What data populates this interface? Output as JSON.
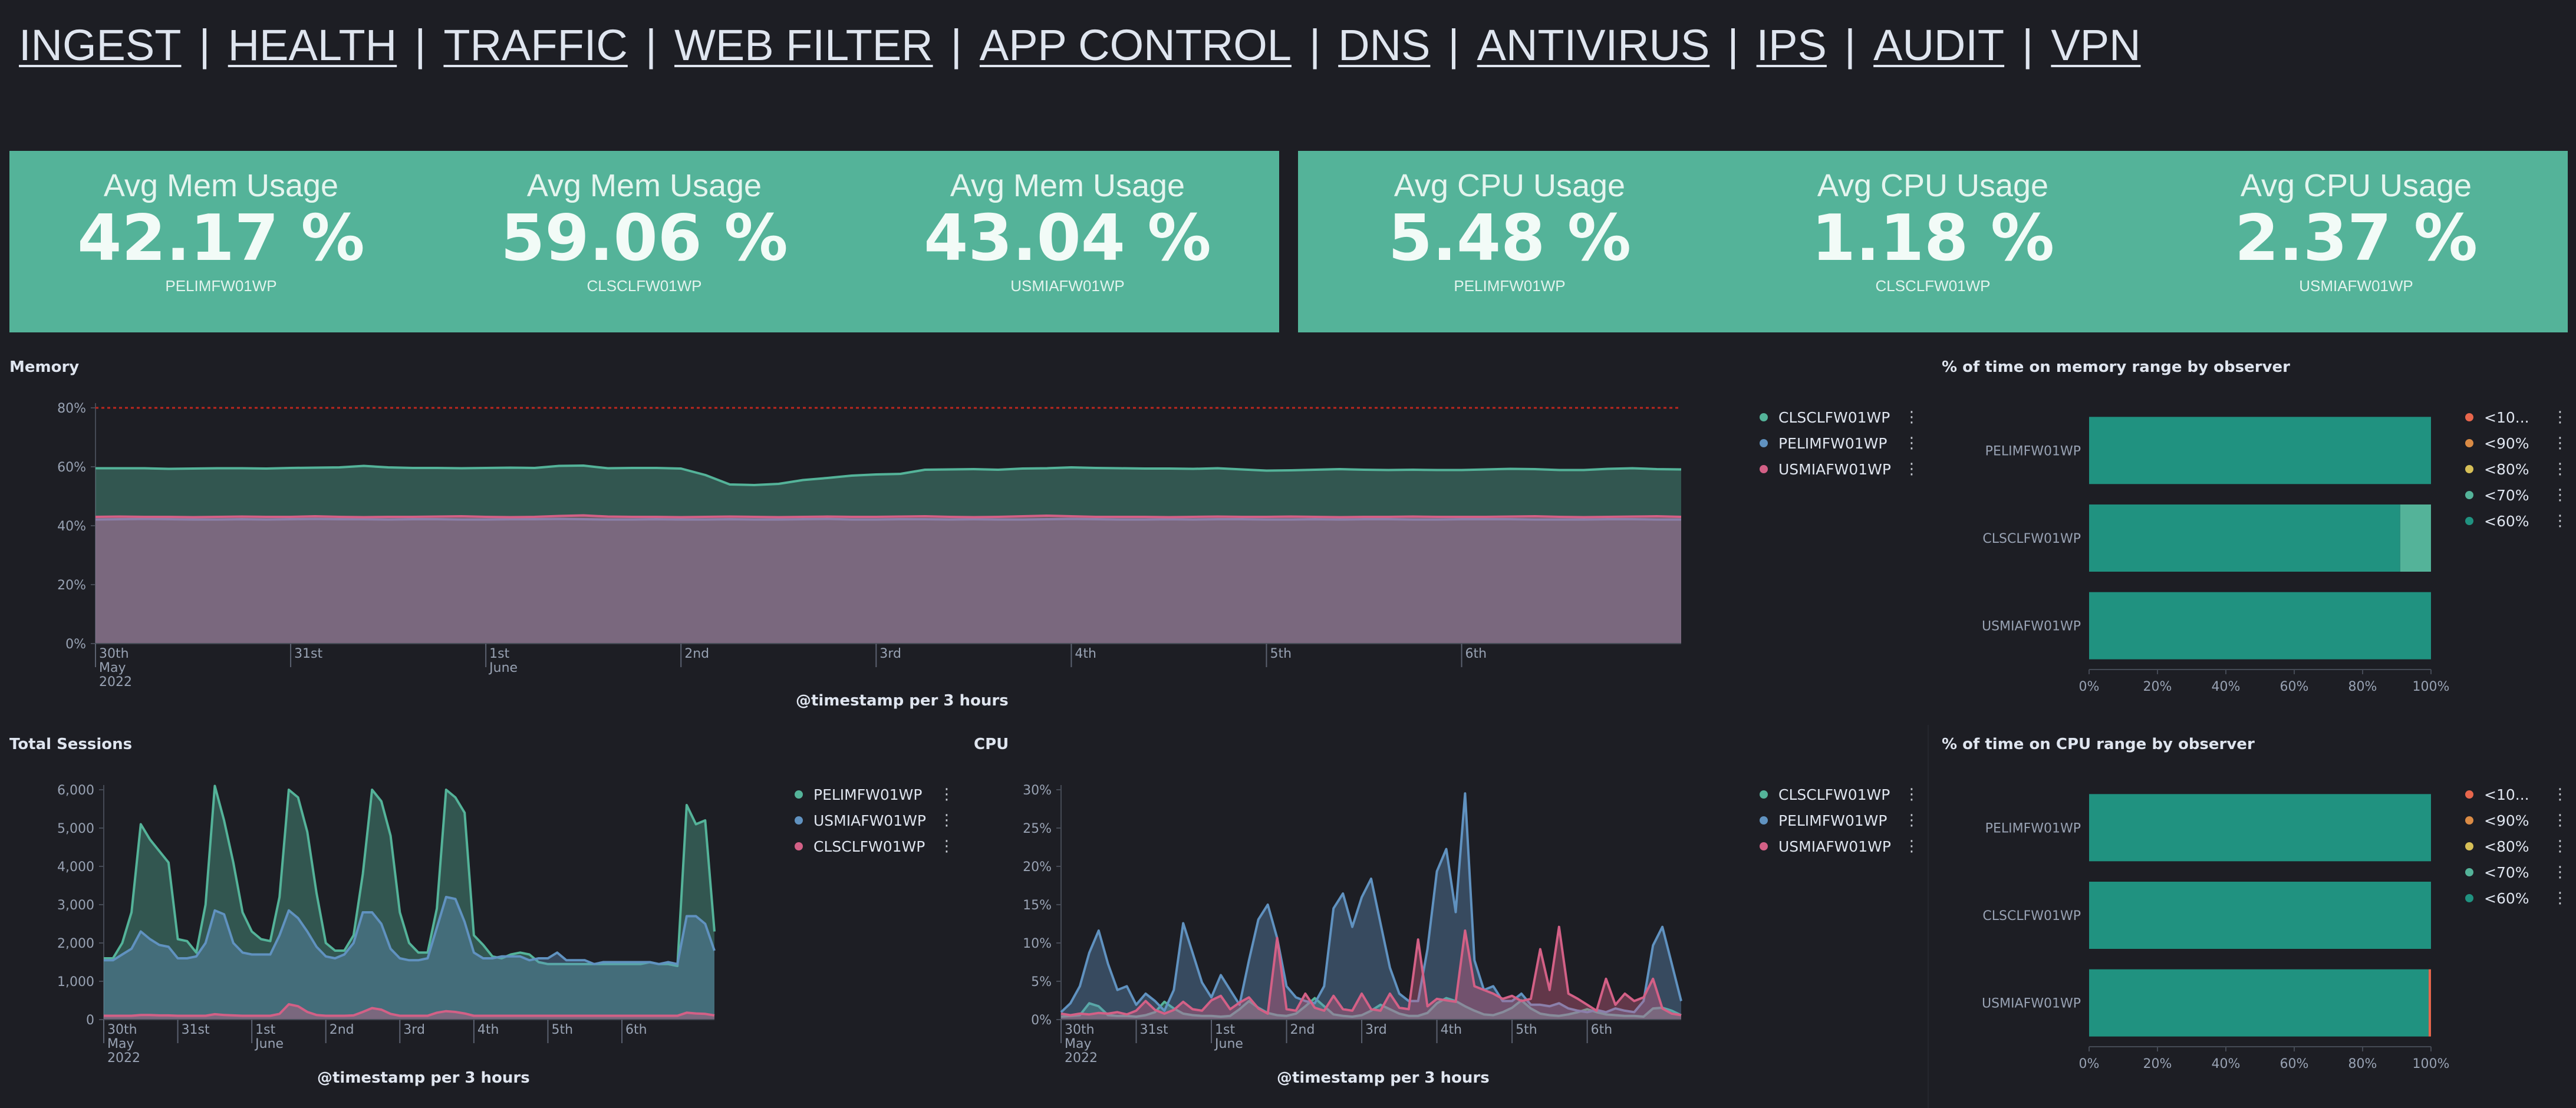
{
  "nav": [
    "INGEST",
    "HEALTH",
    "TRAFFIC",
    "WEB FILTER",
    "APP CONTROL",
    "DNS",
    "ANTIVIRUS",
    "IPS",
    "AUDIT",
    "VPN"
  ],
  "nav_separator": "|",
  "colors": {
    "background": "#1d1e24",
    "metric_panel": "#54b399",
    "green": "#54b399",
    "blue": "#6092c0",
    "pink": "#d36086",
    "red": "#e7664c",
    "orange": "#da8b45",
    "yellow": "#d6bf57",
    "teal_dark": "#209280",
    "threshold": "#bd271e"
  },
  "memory_metrics": {
    "items": [
      {
        "title": "Avg Mem Usage",
        "value": "42.17 %",
        "label": "PELIMFW01WP"
      },
      {
        "title": "Avg Mem Usage",
        "value": "59.06 %",
        "label": "CLSCLFW01WP"
      },
      {
        "title": "Avg Mem Usage",
        "value": "43.04 %",
        "label": "USMIAFW01WP"
      }
    ]
  },
  "cpu_metrics": {
    "items": [
      {
        "title": "Avg CPU Usage",
        "value": "5.48 %",
        "label": "PELIMFW01WP"
      },
      {
        "title": "Avg CPU Usage",
        "value": "1.18 %",
        "label": "CLSCLFW01WP"
      },
      {
        "title": "Avg CPU Usage",
        "value": "2.37 %",
        "label": "USMIAFW01WP"
      }
    ]
  },
  "memory_panel": {
    "title": "Memory",
    "x_axis_title": "@timestamp per 3 hours"
  },
  "sessions_panel": {
    "title": "Total Sessions",
    "x_axis_title": "@timestamp per 3 hours"
  },
  "cpu_panel": {
    "title": "CPU",
    "x_axis_title": "@timestamp per 3 hours"
  },
  "memory_range_panel": {
    "title": "% of time on memory range by observer"
  },
  "cpu_range_panel": {
    "title": "% of time on CPU range by observer"
  },
  "chart_data": [
    {
      "id": "memory",
      "type": "area",
      "title": "Memory",
      "xlabel": "@timestamp per 3 hours",
      "ylabel": "",
      "x_ticks": [
        "30th May 2022",
        "31st",
        "1st June",
        "2nd",
        "3rd",
        "4th",
        "5th",
        "6th"
      ],
      "x_range": [
        "2022-05-30 00:00",
        "2022-06-06 18:00"
      ],
      "y_ticks": [
        "0%",
        "20%",
        "40%",
        "60%",
        "80%"
      ],
      "ylim": [
        0,
        80
      ],
      "threshold": 80,
      "grid": false,
      "legend_position": "right",
      "series": [
        {
          "name": "CLSCLFW01WP",
          "color": "#54b399",
          "values": [
            59.5,
            59.5,
            59.5,
            59.3,
            59.4,
            59.5,
            59.5,
            59.4,
            59.6,
            59.7,
            59.8,
            60.3,
            59.8,
            59.6,
            59.6,
            59.5,
            59.6,
            59.7,
            59.6,
            60.3,
            60.4,
            59.5,
            59.6,
            59.6,
            59.4,
            57.2,
            54,
            53.8,
            54.2,
            55.5,
            56.2,
            57,
            57.4,
            57.6,
            59,
            59.1,
            59.2,
            59,
            59.4,
            59.5,
            59.8,
            59.6,
            59.5,
            59.4,
            59.4,
            59.3,
            59.5,
            59.1,
            58.7,
            58.8,
            59,
            59.2,
            59,
            58.9,
            59,
            58.9,
            58.9,
            59.1,
            59.3,
            59.2,
            58.9,
            58.9,
            59.3,
            59.5,
            59.2,
            59.1
          ]
        },
        {
          "name": "PELIMFW01WP",
          "color": "#6092c0",
          "values": [
            42.1,
            42.2,
            42.3,
            42.2,
            42.1,
            42.1,
            42.2,
            42.1,
            42.2,
            42.3,
            42.2,
            42.2,
            42.1,
            42.2,
            42.2,
            42.1,
            42.1,
            42.2,
            42.2,
            42.3,
            42.2,
            42.1,
            42.1,
            42.2,
            42.1,
            42.1,
            42.2,
            42.1,
            42.1,
            42.2,
            42.3,
            42.1,
            42.1,
            42.2,
            42.2,
            42.1,
            42.2,
            42.1,
            42.1,
            42.2,
            42.3,
            42.2,
            42.1,
            42.1,
            42.2,
            42.1,
            42.2,
            42.2,
            42.1,
            42.1,
            42.2,
            42.1,
            42.2,
            42.2,
            42.1,
            42.1,
            42.2,
            42.2,
            42.2,
            42.1,
            42.1,
            42.1,
            42.2,
            42.2,
            42.1,
            42.1
          ]
        },
        {
          "name": "USMIAFW01WP",
          "color": "#d36086",
          "values": [
            43,
            43.1,
            43,
            43,
            42.9,
            43,
            43.1,
            43,
            43,
            43.2,
            43,
            42.9,
            43,
            43,
            43.1,
            43.2,
            43,
            42.9,
            43,
            43.3,
            43.5,
            43.1,
            43,
            43,
            42.9,
            43,
            43.1,
            43,
            42.9,
            43,
            43.1,
            43,
            43,
            43.1,
            43.2,
            43,
            42.9,
            43,
            43.2,
            43.4,
            43.2,
            43,
            43,
            43,
            42.9,
            43,
            43.1,
            43,
            43,
            43.1,
            43,
            42.9,
            43,
            43,
            43.1,
            43,
            43,
            43,
            43.1,
            43.2,
            43,
            42.9,
            43,
            43.1,
            43.2,
            43
          ]
        }
      ]
    },
    {
      "id": "memory_range",
      "type": "bar",
      "orientation": "horizontal",
      "stacked": true,
      "title": "% of time on memory range by observer",
      "categories": [
        "PELIMFW01WP",
        "CLSCLFW01WP",
        "USMIAFW01WP"
      ],
      "x_ticks": [
        "0%",
        "20%",
        "40%",
        "60%",
        "80%",
        "100%"
      ],
      "xlim": [
        0,
        100
      ],
      "legend_position": "right",
      "series": [
        {
          "name": "<10...",
          "color": "#e7664c",
          "values": [
            0,
            0,
            0
          ]
        },
        {
          "name": "<90%",
          "color": "#da8b45",
          "values": [
            0,
            0,
            0
          ]
        },
        {
          "name": "<80%",
          "color": "#d6bf57",
          "values": [
            0,
            0,
            0
          ]
        },
        {
          "name": "<70%",
          "color": "#54b399",
          "values": [
            0,
            9,
            0
          ]
        },
        {
          "name": "<60%",
          "color": "#209280",
          "values": [
            100,
            91,
            100
          ]
        }
      ]
    },
    {
      "id": "sessions",
      "type": "area",
      "title": "Total Sessions",
      "xlabel": "@timestamp per 3 hours",
      "ylabel": "",
      "x_ticks": [
        "30th May 2022",
        "31st",
        "1st June",
        "2nd",
        "3rd",
        "4th",
        "5th",
        "6th"
      ],
      "x_range": [
        "2022-05-30 00:00",
        "2022-06-06 18:00"
      ],
      "y_ticks": [
        "0",
        "1,000",
        "2,000",
        "3,000",
        "4,000",
        "5,000",
        "6,000"
      ],
      "ylim": [
        0,
        6000
      ],
      "grid": false,
      "legend_position": "right",
      "series": [
        {
          "name": "PELIMFW01WP",
          "color": "#54b399",
          "values": [
            1600,
            1600,
            2000,
            2800,
            5100,
            4700,
            4400,
            4100,
            2100,
            2050,
            1750,
            3000,
            6100,
            5200,
            4100,
            2800,
            2300,
            2100,
            2050,
            3200,
            6000,
            5800,
            4900,
            3300,
            2000,
            1800,
            1800,
            2200,
            3800,
            6000,
            5700,
            4800,
            2800,
            2000,
            1750,
            1750,
            2900,
            6000,
            5800,
            5400,
            2200,
            1950,
            1650,
            1600,
            1700,
            1750,
            1700,
            1500,
            1450,
            1450,
            1450,
            1450,
            1450,
            1450,
            1450,
            1450,
            1450,
            1450,
            1450,
            1500,
            1450,
            1450,
            1400,
            5600,
            5100,
            5200,
            2300
          ]
        },
        {
          "name": "USMIAFW01WP",
          "color": "#6092c0",
          "values": [
            1550,
            1550,
            1700,
            1850,
            2300,
            2100,
            1950,
            1900,
            1600,
            1600,
            1650,
            2000,
            2850,
            2750,
            2000,
            1750,
            1700,
            1700,
            1700,
            2200,
            2850,
            2650,
            2300,
            1900,
            1650,
            1600,
            1700,
            2000,
            2800,
            2800,
            2500,
            1850,
            1600,
            1550,
            1550,
            1600,
            2400,
            3200,
            3150,
            2550,
            1750,
            1600,
            1600,
            1650,
            1650,
            1650,
            1550,
            1600,
            1600,
            1750,
            1550,
            1550,
            1550,
            1450,
            1500,
            1500,
            1500,
            1500,
            1500,
            1500,
            1450,
            1500,
            1450,
            2700,
            2700,
            2500,
            1800
          ]
        },
        {
          "name": "CLSCLFW01WP",
          "color": "#d36086",
          "values": [
            100,
            100,
            100,
            100,
            120,
            120,
            110,
            110,
            100,
            100,
            100,
            100,
            140,
            120,
            110,
            100,
            100,
            100,
            100,
            150,
            400,
            350,
            200,
            120,
            100,
            100,
            100,
            110,
            200,
            300,
            260,
            150,
            100,
            100,
            100,
            100,
            180,
            220,
            200,
            160,
            100,
            100,
            100,
            100,
            100,
            100,
            100,
            100,
            100,
            100,
            100,
            100,
            100,
            100,
            100,
            100,
            100,
            100,
            100,
            100,
            100,
            100,
            100,
            180,
            160,
            150,
            110
          ]
        }
      ]
    },
    {
      "id": "cpu",
      "type": "area",
      "title": "CPU",
      "xlabel": "@timestamp per 3 hours",
      "ylabel": "",
      "x_ticks": [
        "30th May 2022",
        "31st",
        "1st June",
        "2nd",
        "3rd",
        "4th",
        "5th",
        "6th"
      ],
      "x_range": [
        "2022-05-30 00:00",
        "2022-06-06 18:00"
      ],
      "y_ticks": [
        "0%",
        "5%",
        "10%",
        "15%",
        "20%",
        "25%",
        "30%"
      ],
      "ylim": [
        0,
        31
      ],
      "grid": false,
      "legend_position": "right",
      "series": [
        {
          "name": "CLSCLFW01WP",
          "color": "#54b399",
          "values": [
            0.4,
            0.5,
            0.6,
            2.2,
            1.8,
            0.6,
            0.5,
            0.5,
            0.4,
            0.6,
            1,
            2.4,
            1.5,
            0.8,
            0.6,
            0.5,
            0.5,
            0.4,
            0.5,
            1.4,
            2.5,
            1.6,
            0.9,
            0.6,
            0.5,
            0.8,
            1.8,
            2.9,
            1.8,
            0.7,
            0.5,
            0.4,
            0.6,
            1.2,
            2,
            1.4,
            0.8,
            0.5,
            0.5,
            0.9,
            2.2,
            2.9,
            2.5,
            1.8,
            1.2,
            0.7,
            0.6,
            1,
            1.6,
            2.6,
            1.5,
            0.8,
            0.6,
            0.5,
            0.7,
            1,
            1.4,
            1,
            0.7,
            0.6,
            0.5,
            0.5,
            0.4,
            1.5,
            1.6,
            1.2,
            0.6
          ]
        },
        {
          "name": "PELIMFW01WP",
          "color": "#6092c0",
          "values": [
            1,
            2.2,
            4.5,
            9,
            12,
            7.5,
            4,
            4.5,
            2,
            3.5,
            2.5,
            1.2,
            4,
            13,
            9,
            5,
            3,
            6,
            4,
            2,
            8,
            13.5,
            15.5,
            11,
            4.5,
            3,
            2.5,
            2.2,
            4.5,
            15,
            17,
            12.5,
            16.5,
            19,
            13,
            7,
            3.5,
            2.5,
            2.5,
            9.5,
            20,
            23,
            14.5,
            30.5,
            8,
            4,
            4.5,
            2.5,
            2.5,
            3.5,
            2,
            2,
            1.8,
            2.2,
            1.5,
            1.2,
            1,
            1.3,
            1,
            1.5,
            1.2,
            1,
            2.5,
            10,
            12.5,
            7.5,
            2.5
          ]
        },
        {
          "name": "USMIAFW01WP",
          "color": "#d36086",
          "values": [
            0.8,
            0.6,
            0.8,
            0.7,
            0.9,
            0.8,
            1,
            0.7,
            1.2,
            2.5,
            1.3,
            0.8,
            1.3,
            2.4,
            1.4,
            1.2,
            2.6,
            3.2,
            1.4,
            2.3,
            3,
            1.5,
            0.8,
            11,
            1.4,
            1.2,
            3.5,
            1.6,
            1.2,
            3.2,
            1.4,
            1.2,
            3.5,
            1.4,
            1.2,
            3.5,
            1.6,
            1.4,
            10.8,
            1.8,
            2.8,
            2.6,
            2.4,
            12,
            4.5,
            4,
            3.5,
            2.8,
            3.2,
            2.5,
            2.8,
            9.5,
            4,
            12.5,
            3.5,
            2.8,
            2,
            1.2,
            5.5,
            2,
            3.5,
            2.5,
            3,
            5.5,
            1.5,
            0.8,
            0.6
          ]
        }
      ]
    },
    {
      "id": "cpu_range",
      "type": "bar",
      "orientation": "horizontal",
      "stacked": true,
      "title": "% of time on CPU range by observer",
      "categories": [
        "PELIMFW01WP",
        "CLSCLFW01WP",
        "USMIAFW01WP"
      ],
      "x_ticks": [
        "0%",
        "20%",
        "40%",
        "60%",
        "80%",
        "100%"
      ],
      "xlim": [
        0,
        100
      ],
      "legend_position": "right",
      "series": [
        {
          "name": "<10...",
          "color": "#e7664c",
          "values": [
            0,
            0,
            0.7
          ]
        },
        {
          "name": "<90%",
          "color": "#da8b45",
          "values": [
            0,
            0,
            0
          ]
        },
        {
          "name": "<80%",
          "color": "#d6bf57",
          "values": [
            0,
            0,
            0
          ]
        },
        {
          "name": "<70%",
          "color": "#54b399",
          "values": [
            0,
            0,
            0
          ]
        },
        {
          "name": "<60%",
          "color": "#209280",
          "values": [
            100,
            100,
            99.3
          ]
        }
      ]
    }
  ]
}
